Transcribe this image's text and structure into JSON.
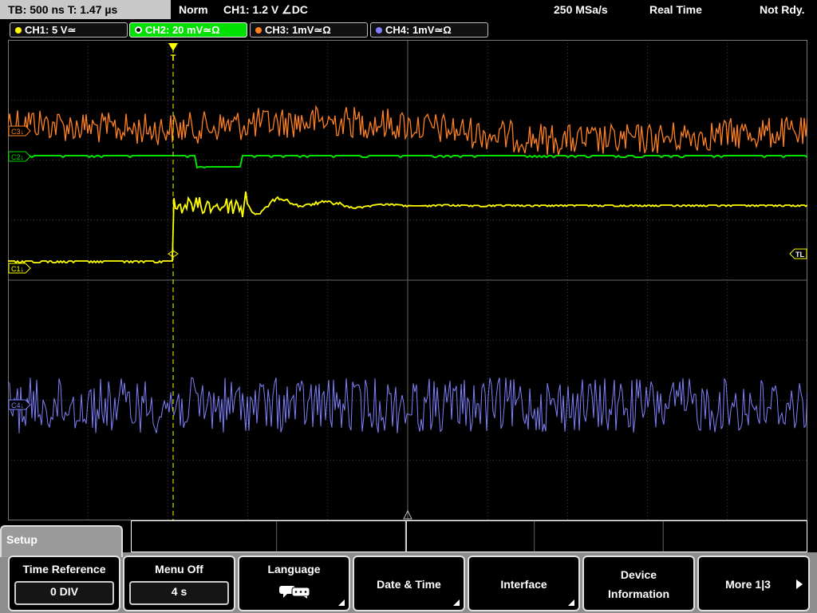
{
  "status_bar": {
    "timebase": "TB: 500 ns   T: 1.47 µs",
    "trigger_mode": "Norm",
    "trigger_info": "CH1: 1.2 V ∠DC",
    "sample_rate": "250 MSa/s",
    "acq_mode": "Real Time",
    "status": "Not Rdy."
  },
  "channels": [
    {
      "label": "CH1: 5 V≃",
      "color": "#ffff00",
      "active": false
    },
    {
      "label": "CH2: 20 mV≃Ω",
      "color": "#00e000",
      "active": true
    },
    {
      "label": "CH3: 1mV≃Ω",
      "color": "#ff8020",
      "active": false
    },
    {
      "label": "CH4: 1mV≃Ω",
      "color": "#8080ff",
      "active": false
    }
  ],
  "markers": {
    "c3": "C3↓",
    "c2": "C2↓",
    "c1": "C1↓",
    "c4": "C4↓",
    "trigger_level": "TL",
    "trigger_pos": "T"
  },
  "menu": {
    "title": "Setup",
    "softkeys": [
      {
        "title": "Time Reference",
        "value": "0 DIV"
      },
      {
        "title": "Menu Off",
        "value": "4 s"
      },
      {
        "title": "Language",
        "icon": "speech-bubble-icon"
      },
      {
        "title": "Date & Time"
      },
      {
        "title": "Interface"
      },
      {
        "title_line1": "Device",
        "title_line2": "Information"
      },
      {
        "title": "More 1|3",
        "icon": "arrow-right-icon"
      }
    ]
  },
  "colors": {
    "ch1": "#ffff00",
    "ch2": "#00e000",
    "ch3": "#ff8020",
    "ch4": "#8080ff",
    "grid": "#555555"
  }
}
